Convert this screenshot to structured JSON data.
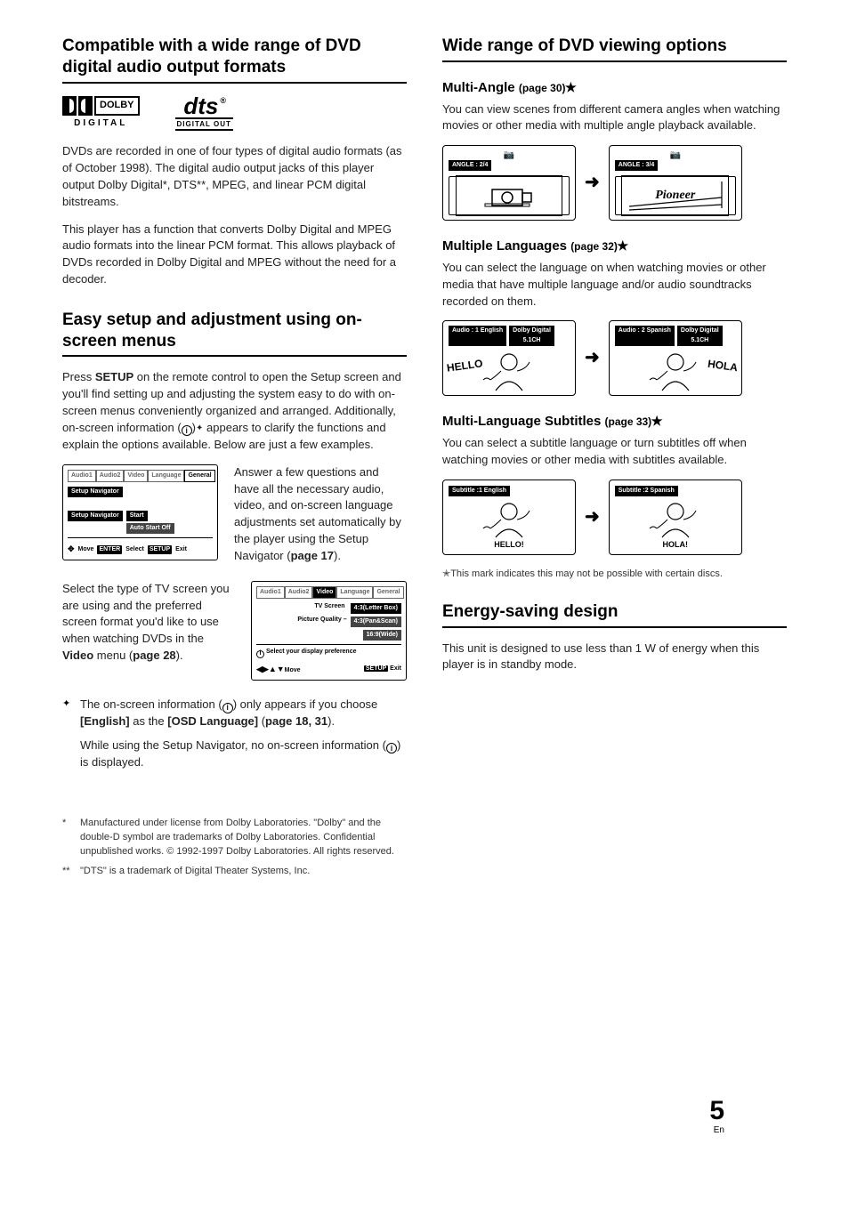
{
  "left": {
    "h_compat": "Compatible with a wide range of DVD digital audio output formats",
    "dolby_word": "DOLBY",
    "dolby_digital": "DIGITAL",
    "dts_word": "dts",
    "dts_sub": "DIGITAL OUT",
    "p_compat1": "DVDs are recorded in one of four types of digital audio formats (as of October 1998). The digital audio output jacks of this player output Dolby Digital*, DTS**, MPEG, and linear PCM digital bitstreams.",
    "p_compat2": "This player has a function that converts Dolby Digital and MPEG audio formats into the linear PCM format. This allows playback of DVDs recorded in Dolby Digital and MPEG without the need for a decoder.",
    "h_setup": "Easy setup and adjustment using on-screen menus",
    "p_setup_pre": "Press ",
    "p_setup_bold": "SETUP",
    "p_setup_post": " on the remote control to open the Setup screen and you'll find setting up and adjusting the system easy to do with on-screen menus conveniently organized and arranged. Additionally, on-screen information (",
    "p_setup_post2": ")",
    "p_setup_post3": " appears to clarify the functions and explain the options available. Below are just a few examples.",
    "nav_para_pre": "Answer a few questions and have all the necessary audio, video, and on-screen language adjustments set automatically by the player using the Setup Navigator (",
    "nav_para_page": "page 17",
    "nav_para_post": ").",
    "tv_para_pre": "Select the type of TV screen you are using and the preferred screen format you'd like to use when watching DVDs in the ",
    "tv_para_bold": "Video",
    "tv_para_post": " menu (",
    "tv_para_page": "page 28",
    "tv_para_post2": ").",
    "note_pre": "The on-screen information (",
    "note_mid": ") only appears if you choose ",
    "note_b1": "[English]",
    "note_mid2": " as the ",
    "note_b2": "[OSD Language]",
    "note_paren": " (",
    "note_page": "page 18, 31",
    "note_paren2": ").",
    "note2_pre": "While using the Setup Navigator, no on-screen information (",
    "note2_post": ") is displayed.",
    "foot1_mark": "*",
    "foot1": "Manufactured under license from Dolby Laboratories. \"Dolby\" and the double-D symbol are trademarks of Dolby Laboratories. Confidential unpublished works. © 1992-1997 Dolby Laboratories. All rights reserved.",
    "foot2_mark": "**",
    "foot2": "\"DTS\" is a trademark of Digital Theater Systems, Inc.",
    "osd1": {
      "tabs": [
        "Audio1",
        "Audio2",
        "Video",
        "Language",
        "General"
      ],
      "chip1": "Setup Navigator",
      "label": "Setup Navigator",
      "opt1": "Start",
      "opt2": "Auto Start Off",
      "foot_move": "Move",
      "foot_enter": "ENTER",
      "foot_select": "Select",
      "foot_setup": "SETUP",
      "foot_exit": "Exit"
    },
    "osd2": {
      "tabs": [
        "Audio1",
        "Audio2",
        "Video",
        "Language",
        "General"
      ],
      "r1l": "TV Screen",
      "r1v": "4:3(Letter Box)",
      "r2l": "Picture Quality –",
      "r2v": "4:3(Pan&Scan)",
      "r3v": "16:9(Wide)",
      "info": "Select your display preference",
      "foot_move": "Move",
      "foot_setup": "SETUP",
      "foot_exit": "Exit"
    }
  },
  "right": {
    "h_wide": "Wide range of DVD viewing options",
    "ma_h": "Multi-Angle ",
    "ma_page": "(page 30)",
    "ma_p": "You can view scenes from different camera angles when watching movies or other media with multiple angle playback available.",
    "ma_bar1": "ANGLE    : 2/4",
    "ma_bar2": "ANGLE    : 3/4",
    "pioneer": "Pioneer",
    "ml_h": "Multiple Languages ",
    "ml_page": "(page 32)",
    "ml_p": "You can select the language on when watching movies or other media that have multiple language and/or audio soundtracks recorded on them.",
    "ml_bar1": "Audio    : 1    English",
    "ml_bar2": "Audio    : 2    Spanish",
    "ml_dd": "Dolby Digital",
    "ml_ch": "5.1CH",
    "hello": "HELLO",
    "hola": "HOLA",
    "mls_h": "Multi-Language Subtitles ",
    "mls_page": "(page 33)",
    "mls_p": "You can select a subtitle language or turn subtitles off when watching movies or other media with subtitles available.",
    "mls_bar1": "Subtitle    :1    English",
    "mls_bar2": "Subtitle    :2    Spanish",
    "hello_sub": "HELLO!",
    "hola_sub": "HOLA!",
    "star_note": "✭This mark indicates this may not be possible with certain discs.",
    "h_energy": "Energy-saving design",
    "p_energy": "This unit is designed to use less than 1 W of energy when this player is in standby mode."
  },
  "page": {
    "num": "5",
    "lang": "En"
  }
}
